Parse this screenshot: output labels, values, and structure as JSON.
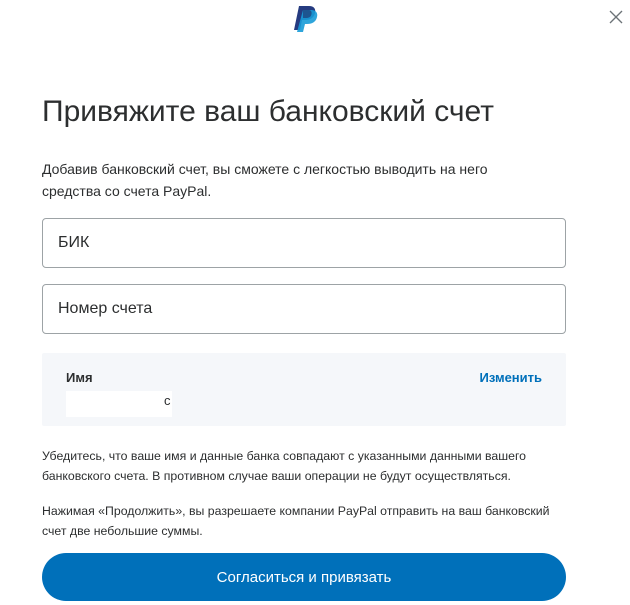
{
  "header": {
    "logo_icon": "paypal-logo",
    "close_icon": "close-icon"
  },
  "title": "Привяжите ваш банковский счет",
  "description": "Добавив банковский счет, вы сможете с легкостью выводить на него средства со счета PayPal.",
  "fields": {
    "bik_placeholder": "БИК",
    "account_placeholder": "Номер счета"
  },
  "name_section": {
    "label": "Имя",
    "change_label": "Изменить",
    "value_tail": "с"
  },
  "notes": {
    "match_warning": "Убедитесь, что ваше имя и данные банка совпадают с указанными данными вашего банковского счета. В противном случае ваши операции не будут осуществляться.",
    "consent": "Нажимая «Продолжить», вы разрешаете компании PayPal отправить на ваш банковский счет две небольшие суммы."
  },
  "submit_label": "Согласиться и привязать",
  "colors": {
    "accent": "#0070ba",
    "logo_dark": "#253b80",
    "logo_light": "#179bd7"
  }
}
